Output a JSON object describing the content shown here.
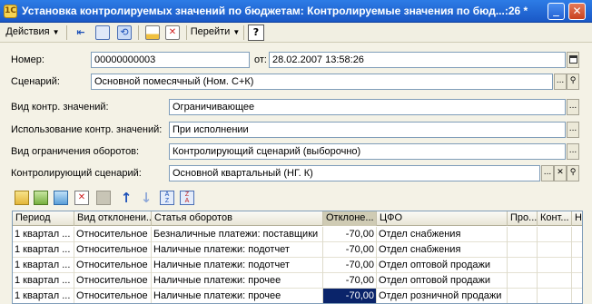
{
  "window": {
    "title": "Установка контролируемых значений по бюджетам: Контролируемые значения по бюд...:26 *",
    "minimize_glyph": "_",
    "close_glyph": "✕"
  },
  "toolbar": {
    "actions_label": "Действия",
    "goto_label": "Перейти",
    "help_glyph": "?"
  },
  "form": {
    "number_label": "Номер:",
    "number_value": "00000000003",
    "date_label": "от:",
    "date_value": "28.02.2007 13:58:26",
    "scenario_label": "Сценарий:",
    "scenario_value": "Основной помесячный (Ном. С+К)",
    "control_type_label": "Вид контр. значений:",
    "control_type_value": "Ограничивающее",
    "usage_label": "Использование контр. значений:",
    "usage_value": "При исполнении",
    "turnover_limit_label": "Вид ограничения оборотов:",
    "turnover_limit_value": "Контролирующий сценарий (выборочно)",
    "control_scenario_label": "Контролирующий сценарий:",
    "control_scenario_value": "Основной квартальный (НГ. К)"
  },
  "table": {
    "columns": [
      "Период",
      "Вид отклонени...",
      "Статья оборотов",
      "Отклоне...",
      "ЦФО",
      "Про...",
      "Конт...",
      "Н"
    ],
    "rows": [
      [
        "1 квартал ...",
        "Относительное",
        "Безналичные платежи: поставщики",
        "-70,00",
        "Отдел снабжения",
        "",
        "",
        ""
      ],
      [
        "1 квартал ...",
        "Относительное",
        "Наличные платежи: подотчет",
        "-70,00",
        "Отдел снабжения",
        "",
        "",
        ""
      ],
      [
        "1 квартал ...",
        "Относительное",
        "Наличные платежи: подотчет",
        "-70,00",
        "Отдел оптовой продажи",
        "",
        "",
        ""
      ],
      [
        "1 квартал ...",
        "Относительное",
        "Наличные платежи: прочее",
        "-70,00",
        "Отдел оптовой продажи",
        "",
        "",
        ""
      ],
      [
        "1 квартал ...",
        "Относительное",
        "Наличные платежи: прочее",
        "-70,00",
        "Отдел розничной продажи",
        "",
        "",
        ""
      ]
    ]
  },
  "icons": {
    "ellipsis": "...",
    "search": "⚲",
    "clear": "✕",
    "arrow_up": "↑",
    "arrow_down": "↓"
  }
}
